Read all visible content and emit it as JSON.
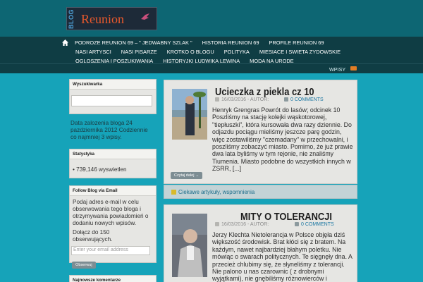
{
  "logo": {
    "blog_text": "BLOG",
    "name": "Reunion"
  },
  "nav": {
    "row1": [
      "PODROZE REUNION 69 – \" JEDWABNY SZLAK \"",
      "HISTORIA REUNION 69",
      "PROFILE REUNION 69"
    ],
    "row2": [
      "NASI ARTYSCI",
      "NASI PISARZE",
      "KROTKO O BLOGU",
      "POLITYKA",
      "MIESIACE I SWIETA ZYDOWSKIE"
    ],
    "row3": [
      "OGLOSZENIA I POSZUKIWANIA",
      "HISTORYJKI LUDWIKA LEWINA",
      "MODA NA URODE"
    ]
  },
  "subbar": {
    "wpisy": "WPISY",
    "rss_icon": "rss-icon"
  },
  "sidebar": {
    "search_title": "Wyszukiwarka",
    "blog_info": "Data zalozenia bloga 24 pazdziernika 2012 Codziennie co najmniej 3 wpisy.",
    "stats_title": "Statystyka",
    "stats_value": "739,146 wyswietlen",
    "follow_title": "Follow Blog via Email",
    "follow_text": "Podaj adres e-mail w celu obserwowania tego bloga i otrzymywania powiadomień o dodaniu nowych wpisów.",
    "follow_count": "Dołącz do 150 obserwujących.",
    "email_placeholder": "Enter your email address",
    "follow_button": "Obserwuj",
    "recent_comments_title": "Najnowsze komentarze"
  },
  "posts": [
    {
      "title": "Ucieczka z piekla cz 10",
      "date": "16/03/2016",
      "author": "AUTOR:",
      "comments": "0 COMMENTS",
      "body": "Henryk Grengras Powrót do lasów; odcinek 10 Poszliśmy na stację kolejki wąskotorowej, \"tiepłuszki\", która kursowała dwa razy dziennie. Do odjazdu pociągu mieliśmy jeszcze parę godzin, więc zostawiliśmy \"czemadany\" w przechowalni, i poszliśmy zobaczyć miasto. Pomimo, że już prawie dwa lata byliśmy w tym rejonie, nie znaliśmy Tiumenia. Miasto podobne do wszystkich innych w ZSRR, [...]",
      "more": "Czytaj dalej →",
      "category_prefix": "Ciekawe artykuły",
      "category": "wspomnienia"
    },
    {
      "title": "MITY O TOLERANCJI",
      "date": "16/03/2016",
      "author": "AUTOR:",
      "comments": "0 COMMENTS",
      "body": "Jerzy Klechta Nietolerancja w Polsce objęła dziś większość środowisk. Brat kłóci się z bratem. Na każdym, nawet najbardziej błahym poletku. Nie mówiąc o swarach politycznych. Te sięgnęły dna. A przecież chlubimy się, że słyneliśmy z tolerancji. Nie palono u nas czarownic ( z drobnymi wyjątkami), nie gnębiliśmy różnowierców i żadnych... "
    }
  ]
}
